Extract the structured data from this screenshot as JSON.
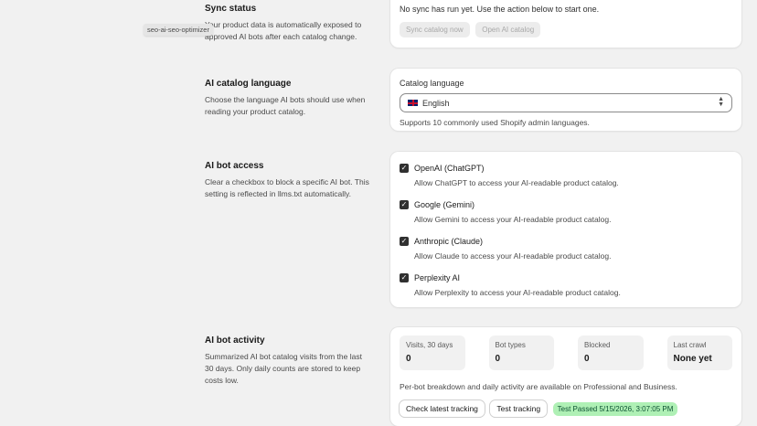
{
  "tooltip": "seo-ai-seo-optimizer",
  "sync": {
    "title": "Sync status",
    "description": "Your product data is automatically exposed to approved AI bots after each catalog change.",
    "message": "No sync has run yet. Use the action below to start one.",
    "sync_button": "Sync catalog now",
    "open_button": "Open AI catalog"
  },
  "language": {
    "title": "AI catalog language",
    "description": "Choose the language AI bots should use when reading your product catalog.",
    "field_label": "Catalog language",
    "selected": "English",
    "flag_icon": "uk-flag-icon",
    "help": "Supports 10 commonly used Shopify admin languages."
  },
  "bots": {
    "title": "AI bot access",
    "description": "Clear a checkbox to block a specific AI bot. This setting is reflected in llms.txt automatically.",
    "items": [
      {
        "name": "OpenAI (ChatGPT)",
        "help": "Allow ChatGPT to access your AI-readable product catalog.",
        "checked": true
      },
      {
        "name": "Google (Gemini)",
        "help": "Allow Gemini to access your AI-readable product catalog.",
        "checked": true
      },
      {
        "name": "Anthropic (Claude)",
        "help": "Allow Claude to access your AI-readable product catalog.",
        "checked": true
      },
      {
        "name": "Perplexity AI",
        "help": "Allow Perplexity to access your AI-readable product catalog.",
        "checked": true
      }
    ]
  },
  "activity": {
    "title": "AI bot activity",
    "description": "Summarized AI bot catalog visits from the last 30 days. Only daily counts are stored to keep costs low.",
    "stats": [
      {
        "label": "Visits, 30 days",
        "value": "0"
      },
      {
        "label": "Bot types",
        "value": "0"
      },
      {
        "label": "Blocked",
        "value": "0"
      },
      {
        "label": "Last crawl",
        "value": "None yet"
      }
    ],
    "note": "Per-bot breakdown and daily activity are available on Professional and Business.",
    "check_button": "Check latest tracking",
    "test_button": "Test tracking",
    "badge": "Test Passed 5/15/2026, 3:07:05 PM",
    "badge_color": "#aff0b5"
  }
}
